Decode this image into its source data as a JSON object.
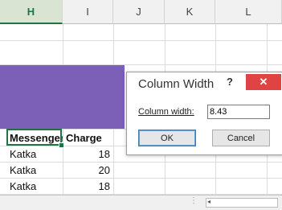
{
  "columns": [
    "H",
    "I",
    "J",
    "K",
    "L"
  ],
  "table": {
    "headers": [
      "Messenger",
      "Charge"
    ],
    "rows": [
      [
        "Katka",
        "18"
      ],
      [
        "Katka",
        "20"
      ],
      [
        "Katka",
        "18"
      ]
    ]
  },
  "fill_color": "#7c5fb6",
  "dialog": {
    "title": "Column Width",
    "help": "?",
    "close": "✕",
    "label": "Column width:",
    "value": "8.43",
    "ok": "OK",
    "cancel": "Cancel"
  },
  "statusbar": {
    "dots": "⋮",
    "scroll_left": "◂"
  }
}
